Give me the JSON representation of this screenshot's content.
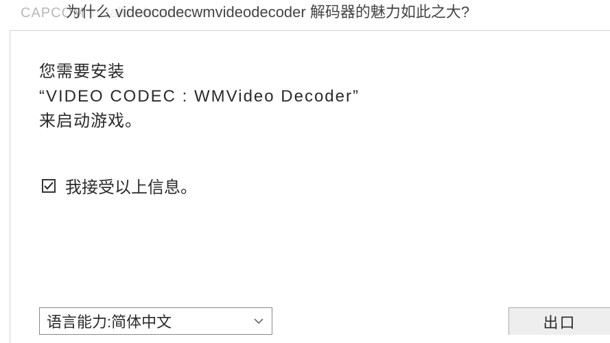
{
  "header": {
    "brand": "CAPCOM",
    "installer_label": "InstallerMessage",
    "overlay_title": "为什么 videocodecwmvideodecoder 解码器的魅力如此之大?"
  },
  "message": {
    "line1": "您需要安装",
    "line2": "“VIDEO CODEC : WMVideo Decoder”",
    "line3": "来启动游戏。"
  },
  "accept": {
    "checked": true,
    "label": "我接受以上信息。"
  },
  "language": {
    "prefix": "语言能力:",
    "selected": "简体中文"
  },
  "buttons": {
    "exit": "出口"
  }
}
